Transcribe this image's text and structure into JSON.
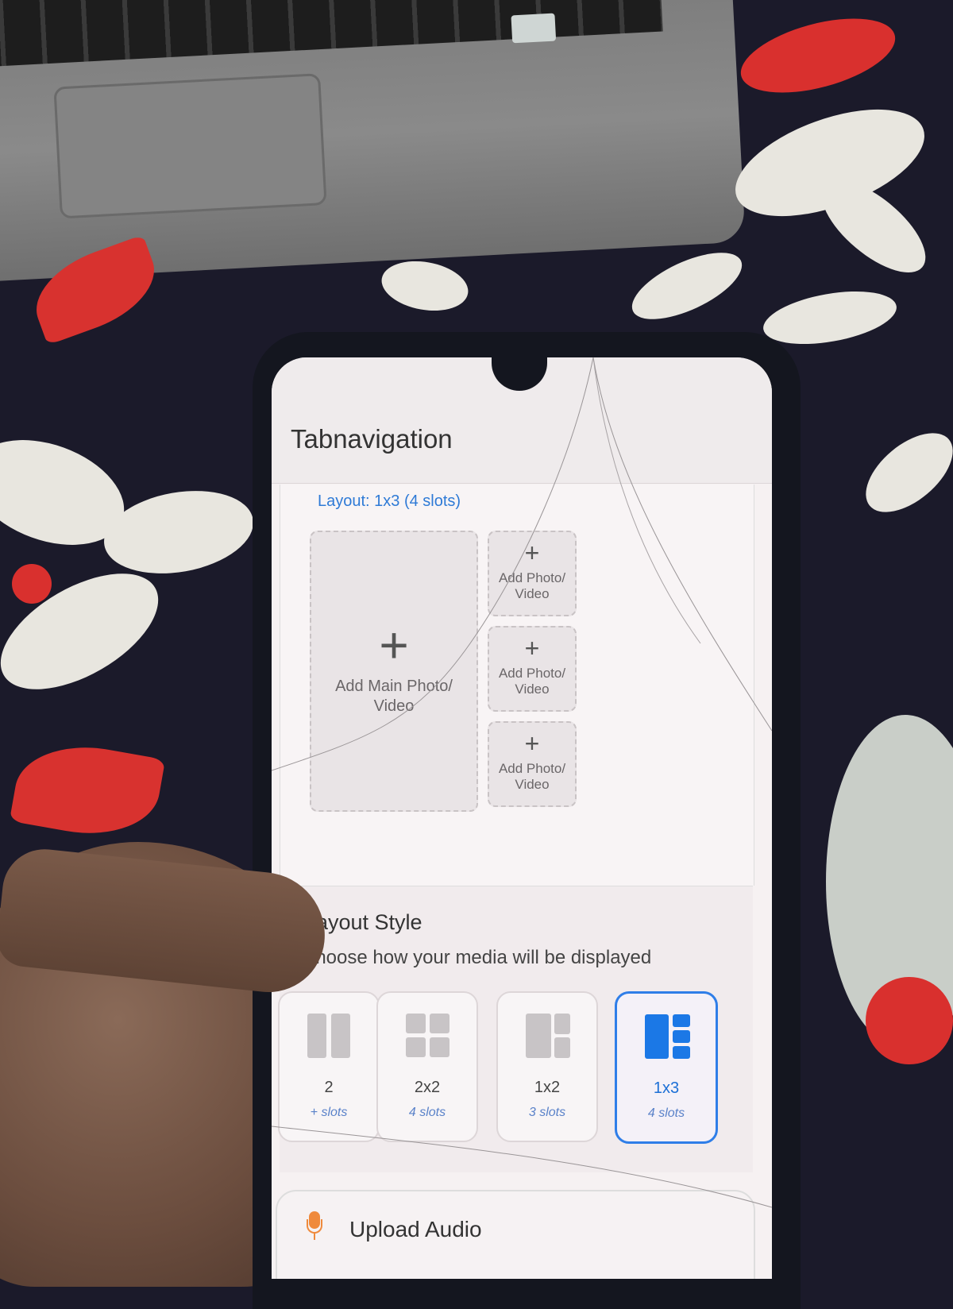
{
  "app": {
    "title": "Tabnavigation"
  },
  "layout_preview": {
    "label": "Layout: 1x3 (4 slots)",
    "main_slot": {
      "icon": "plus-icon",
      "label": "Add Main Photo/ Video"
    },
    "side_slots": [
      {
        "icon": "plus-icon",
        "label": "Add Photo/ Video"
      },
      {
        "icon": "plus-icon",
        "label": "Add Photo/ Video"
      },
      {
        "icon": "plus-icon",
        "label": "Add Photo/ Video"
      }
    ]
  },
  "layout_style": {
    "title": "ayout Style",
    "subtitle": "Choose how your media will be displayed",
    "options": [
      {
        "name": "2",
        "slots": "+ slots",
        "icon": "two-column-layout-icon",
        "selected": false
      },
      {
        "name": "2x2",
        "slots": "4 slots",
        "icon": "grid-2x2-layout-icon",
        "selected": false
      },
      {
        "name": "1x2",
        "slots": "3 slots",
        "icon": "one-plus-two-layout-icon",
        "selected": false
      },
      {
        "name": "1x3",
        "slots": "4 slots",
        "icon": "one-plus-three-layout-icon",
        "selected": true
      }
    ]
  },
  "audio": {
    "icon": "microphone-icon",
    "label": "Upload Audio"
  },
  "colors": {
    "accent": "#1b78e6",
    "mic": "#ef8a3c",
    "background": "#f6f1f2"
  }
}
